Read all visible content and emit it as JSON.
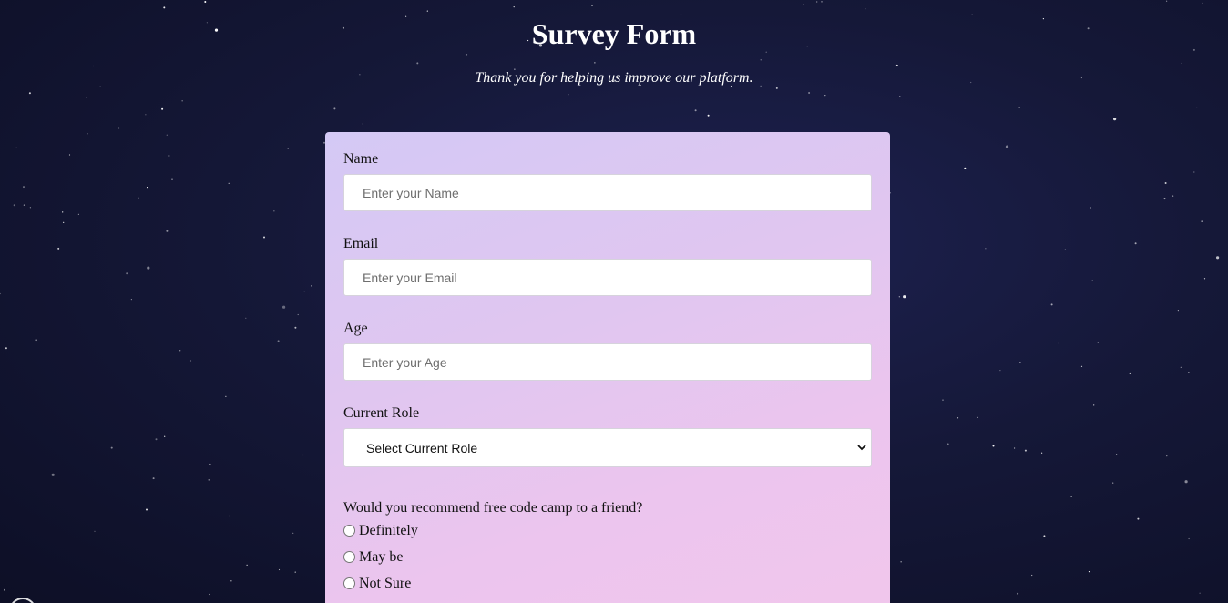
{
  "header": {
    "title": "Survey Form",
    "description": "Thank you for helping us improve our platform."
  },
  "form": {
    "name": {
      "label": "Name",
      "placeholder": "Enter your Name",
      "value": ""
    },
    "email": {
      "label": "Email",
      "placeholder": "Enter your Email",
      "value": ""
    },
    "age": {
      "label": "Age",
      "placeholder": "Enter your Age",
      "value": ""
    },
    "role": {
      "label": "Current Role",
      "selected": "Select Current Role"
    },
    "recommend": {
      "question": "Would you recommend free code camp to a friend?",
      "options": [
        {
          "label": "Definitely",
          "checked": false
        },
        {
          "label": "May be",
          "checked": false
        },
        {
          "label": "Not Sure",
          "checked": false
        }
      ]
    }
  },
  "colors": {
    "background": "#151838",
    "card_top": "#d4c9f5",
    "card_bottom": "#f1c6ec",
    "title_text": "#ffffff"
  },
  "icons": {
    "select_arrow": "chevron-down-icon",
    "radio": "radio-button-icon"
  }
}
